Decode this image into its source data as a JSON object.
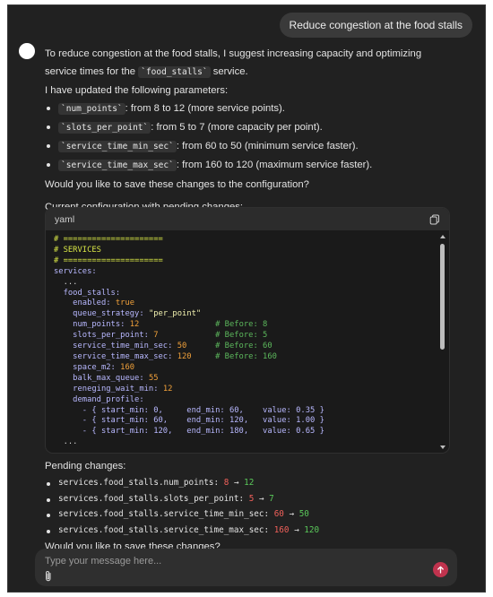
{
  "user_message": "Reduce congestion at the food stalls",
  "assistant": {
    "intro_1": "To reduce congestion at the food stalls, I suggest increasing capacity and optimizing",
    "intro_2_pre": "service times for the",
    "intro_2_code": "`food_stalls`",
    "intro_2_post": "service.",
    "updated_heading": "I have updated the following parameters:",
    "params": [
      {
        "code": "`num_points`",
        "text": ": from 8 to 12 (more service points)."
      },
      {
        "code": "`slots_per_point`",
        "text": ": from 5 to 7 (more capacity per point)."
      },
      {
        "code": "`service_time_min_sec`",
        "text": ": from 60 to 50 (minimum service faster)."
      },
      {
        "code": "`service_time_max_sec`",
        "text": ": from 160 to 120 (maximum service faster)."
      }
    ],
    "question_1": "Would you like to save these changes to the configuration?",
    "config_heading": "Current configuration with pending changes:"
  },
  "codebox": {
    "language": "yaml",
    "lines": {
      "l1": "# =====================",
      "l2": "# SERVICES",
      "l3": "# =====================",
      "l4": "services:",
      "l5": "  ...",
      "l6_key": "  food_stalls:",
      "l7_key": "    enabled: ",
      "l7_val": "true",
      "l8_key": "    queue_strategy: ",
      "l8_val": "\"per_point\"",
      "l9_key": "    num_points: ",
      "l9_val": "12",
      "l9_pad": "                ",
      "l9_com": "# Before: 8",
      "l10_key": "    slots_per_point: ",
      "l10_val": "7",
      "l10_pad": "            ",
      "l10_com": "# Before: 5",
      "l11_key": "    service_time_min_sec: ",
      "l11_val": "50",
      "l11_pad": "      ",
      "l11_com": "# Before: 60",
      "l12_key": "    service_time_max_sec: ",
      "l12_val": "120",
      "l12_pad": "     ",
      "l12_com": "# Before: 160",
      "l13_key": "    space_m2: ",
      "l13_val": "160",
      "l14_key": "    balk_max_queue: ",
      "l14_val": "55",
      "l15_key": "    reneging_wait_min: ",
      "l15_val": "12",
      "l16_key": "    demand_profile:",
      "l17": "      - { start_min: 0,     end_min: 60,    value: 0.35 }",
      "l18": "      - { start_min: 60,    end_min: 120,   value: 1.00 }",
      "l19": "      - { start_min: 120,   end_min: 180,   value: 0.65 }",
      "l20": "  ..."
    }
  },
  "pending": {
    "heading": "Pending changes:",
    "items": [
      {
        "path": "services.food_stalls.num_points: ",
        "old": "8",
        "arrow": " → ",
        "new": "12"
      },
      {
        "path": "services.food_stalls.slots_per_point: ",
        "old": "5",
        "arrow": " → ",
        "new": "7"
      },
      {
        "path": "services.food_stalls.service_time_min_sec: ",
        "old": "60",
        "arrow": " → ",
        "new": "50"
      },
      {
        "path": "services.food_stalls.service_time_max_sec: ",
        "old": "160",
        "arrow": " → ",
        "new": "120"
      }
    ],
    "question": "Would you like to save these changes?"
  },
  "composer": {
    "placeholder": "Type your message here...",
    "send_icon": "arrow-up-icon",
    "attach_icon": "paperclip-icon",
    "send_color": "#c0334e"
  }
}
